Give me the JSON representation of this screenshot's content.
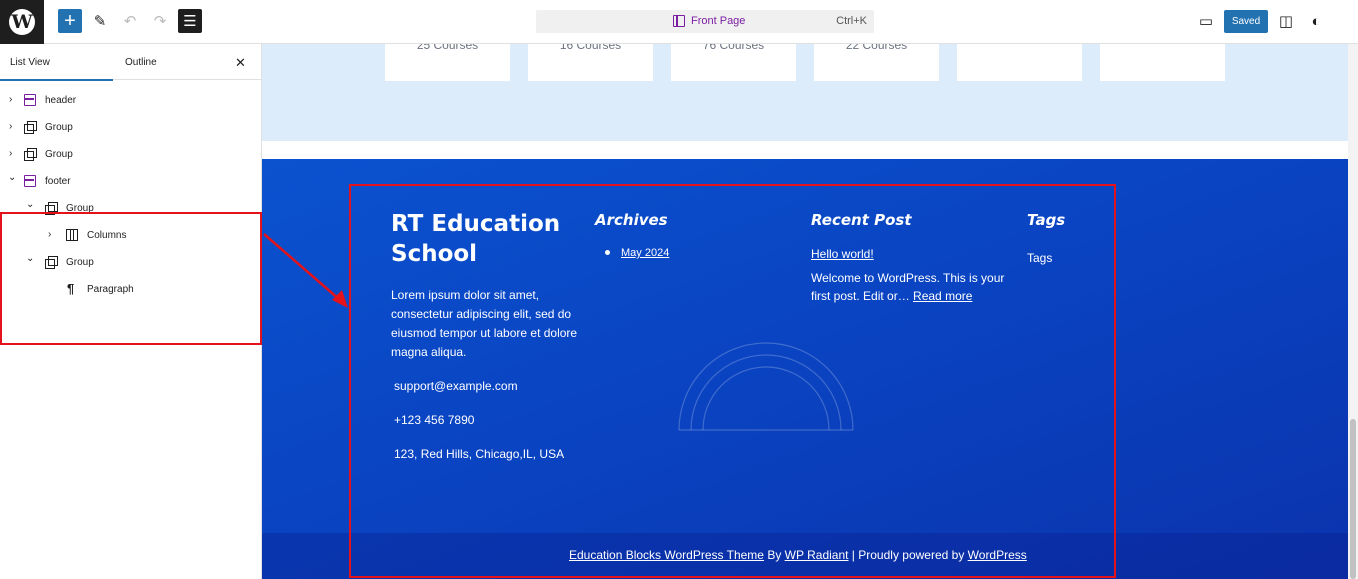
{
  "toolbar": {
    "logo": "W",
    "add_icon": "+",
    "tools_icon": "✎",
    "undo_icon": "↶",
    "redo_icon": "↷",
    "doc_overview_icon": "☰",
    "command": {
      "title": "Front Page",
      "shortcut": "Ctrl+K"
    },
    "device_icon": "▭",
    "saved_label": "Saved",
    "settings_icon": "◫",
    "styles_icon": "◐"
  },
  "sidebar": {
    "tabs": [
      "List View",
      "Outline"
    ],
    "close_icon": "✕",
    "items": [
      {
        "label": "header",
        "icon": "template-part-icon",
        "chevron": "›"
      },
      {
        "label": "Group",
        "icon": "group-icon",
        "chevron": "›"
      },
      {
        "label": "Group",
        "icon": "group-icon",
        "chevron": "›"
      },
      {
        "label": "footer",
        "icon": "template-part-icon",
        "chevron": "⌄"
      },
      {
        "label": "Group",
        "icon": "group-icon",
        "chevron": "⌄"
      },
      {
        "label": "Columns",
        "icon": "columns-icon",
        "chevron": "›"
      },
      {
        "label": "Group",
        "icon": "group-icon",
        "chevron": "⌄"
      },
      {
        "label": "Paragraph",
        "icon": "paragraph-icon",
        "glyph": "¶"
      }
    ]
  },
  "courses": [
    "25 Courses",
    "16 Courses",
    "76 Courses",
    "22 Courses"
  ],
  "footer": {
    "title": "RT Education School",
    "description": "Lorem ipsum dolor sit amet, consectetur adipiscing elit, sed do eiusmod tempor ut labore et dolore magna aliqua.",
    "email": "support@example.com",
    "phone": "+123 456 7890",
    "address": "123, Red Hills, Chicago,IL, USA",
    "archives": {
      "heading": "Archives",
      "items": [
        "May 2024"
      ]
    },
    "recent": {
      "heading": "Recent Post",
      "post_title": "Hello world!",
      "excerpt": "Welcome to WordPress. This is your first post. Edit or…",
      "read_more": "Read more"
    },
    "tags": {
      "heading": "Tags",
      "text": "Tags"
    },
    "credits": {
      "theme_link": "Education Blocks WordPress Theme",
      "by": " By ",
      "author_link": "WP Radiant",
      "powered": " | Proudly powered by ",
      "wp_link": "WordPress"
    }
  },
  "colors": {
    "accent": "#2271b1",
    "highlight": "#e3121b",
    "footer_bg": "#0a44c2",
    "template_icon": "#7b1fa2"
  }
}
